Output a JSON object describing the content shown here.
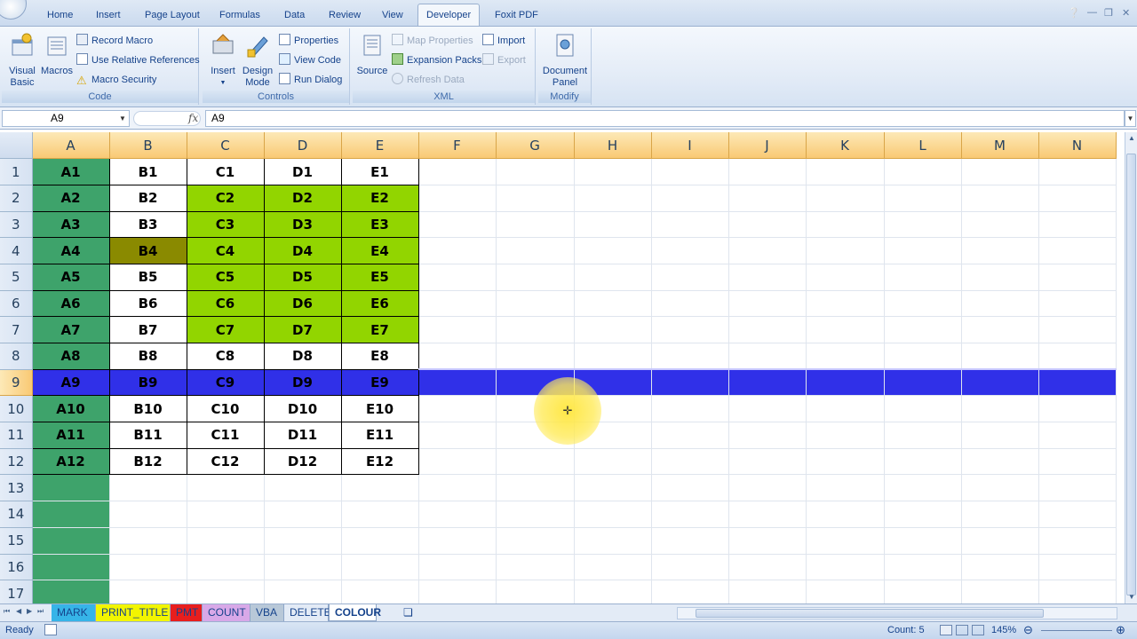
{
  "ribbon_tabs": [
    "Home",
    "Insert",
    "Page Layout",
    "Formulas",
    "Data",
    "Review",
    "View",
    "Developer",
    "Foxit PDF"
  ],
  "active_tab": "Developer",
  "groups": {
    "code": {
      "label": "Code",
      "visual_basic": "Visual Basic",
      "macros": "Macros",
      "record_macro": "Record Macro",
      "relative_refs": "Use Relative References",
      "macro_security": "Macro Security"
    },
    "controls": {
      "label": "Controls",
      "insert": "Insert",
      "design_mode": "Design Mode",
      "properties": "Properties",
      "view_code": "View Code",
      "run_dialog": "Run Dialog"
    },
    "xml": {
      "label": "XML",
      "source": "Source",
      "map_properties": "Map Properties",
      "expansion_packs": "Expansion Packs",
      "refresh_data": "Refresh Data",
      "import": "Import",
      "export": "Export"
    },
    "modify": {
      "label": "Modify",
      "document_panel": "Document Panel"
    }
  },
  "formula_bar": {
    "name_box": "A9",
    "fx": "fx",
    "formula": "A9"
  },
  "columns": [
    "A",
    "B",
    "C",
    "D",
    "E",
    "F",
    "G",
    "H",
    "I",
    "J",
    "K",
    "L",
    "M",
    "N"
  ],
  "rows": [
    [
      "A1",
      "B1",
      "C1",
      "D1",
      "E1"
    ],
    [
      "A2",
      "B2",
      "C2",
      "D2",
      "E2"
    ],
    [
      "A3",
      "B3",
      "C3",
      "D3",
      "E3"
    ],
    [
      "A4",
      "B4",
      "C4",
      "D4",
      "E4"
    ],
    [
      "A5",
      "B5",
      "C5",
      "D5",
      "E5"
    ],
    [
      "A6",
      "B6",
      "C6",
      "D6",
      "E6"
    ],
    [
      "A7",
      "B7",
      "C7",
      "D7",
      "E7"
    ],
    [
      "A8",
      "B8",
      "C8",
      "D8",
      "E8"
    ],
    [
      "A9",
      "B9",
      "C9",
      "D9",
      "E9"
    ],
    [
      "A10",
      "B10",
      "C10",
      "D10",
      "E10"
    ],
    [
      "A11",
      "B11",
      "C11",
      "D11",
      "E11"
    ],
    [
      "A12",
      "B12",
      "C12",
      "D12",
      "E12"
    ],
    [],
    [],
    [],
    [],
    []
  ],
  "selected_row": 9,
  "colors": {
    "green_col": "#3ea36b",
    "lime": "#92d500",
    "olive": "#8a8a00",
    "selection": "#3030e8"
  },
  "sheet_tabs": [
    {
      "label": "MARK",
      "color": "#36b4e8"
    },
    {
      "label": "PRINT_TITLE",
      "color": "#f2f500"
    },
    {
      "label": "PMT",
      "color": "#e81e1e"
    },
    {
      "label": "COUNT",
      "color": "#d8a8e8"
    },
    {
      "label": "VBA",
      "color": "#b8c8d8"
    },
    {
      "label": "DELETE",
      "color": ""
    },
    {
      "label": "COLOUR",
      "color": ""
    }
  ],
  "active_sheet": "COLOUR",
  "status": {
    "ready": "Ready",
    "count": "Count: 5",
    "zoom": "145%"
  }
}
